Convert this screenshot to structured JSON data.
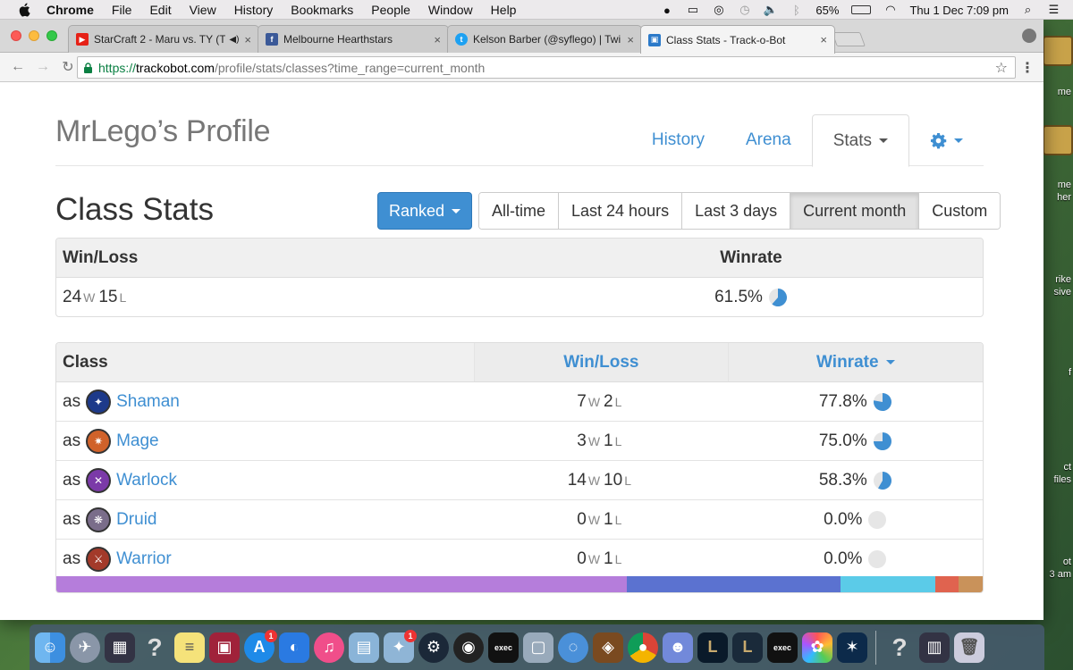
{
  "menubar": {
    "app_name": "Chrome",
    "menus": [
      "File",
      "Edit",
      "View",
      "History",
      "Bookmarks",
      "People",
      "Window",
      "Help"
    ],
    "battery": "65%",
    "clock": "Thu 1 Dec  7:09 pm"
  },
  "browser": {
    "tabs": [
      {
        "title": "StarCraft 2 - Maru vs. TY (T",
        "icon": "youtube-icon",
        "color": "#e62117"
      },
      {
        "title": "Melbourne Hearthstars",
        "icon": "facebook-icon",
        "color": "#3b5998"
      },
      {
        "title": "Kelson Barber (@syflego) | Twi",
        "icon": "twitter-icon",
        "color": "#1da1f2"
      },
      {
        "title": "Class Stats - Track-o-Bot",
        "icon": "trackobot-icon",
        "color": "#2c7ac9"
      }
    ],
    "url": {
      "scheme": "https://",
      "host": "trackobot.com",
      "path": "/profile/stats/classes?time_range=current_month"
    }
  },
  "page": {
    "profile_title": "MrLego’s Profile",
    "nav": {
      "history": "History",
      "arena": "Arena",
      "stats": "Stats"
    },
    "section_title": "Class Stats",
    "mode_button": "Ranked",
    "time_ranges": [
      "All-time",
      "Last 24 hours",
      "Last 3 days",
      "Current month",
      "Custom"
    ],
    "active_range": "Current month",
    "summary": {
      "col_winloss": "Win/Loss",
      "col_winrate": "Winrate",
      "wins": "24",
      "losses": "15",
      "win_suffix": "W",
      "loss_suffix": "L",
      "winrate": "61.5%",
      "winrate_fraction": 0.615
    },
    "classes_table": {
      "col_class": "Class",
      "col_winloss": "Win/Loss",
      "col_winrate": "Winrate",
      "as_label": "as",
      "rows": [
        {
          "name": "Shaman",
          "wins": "7",
          "losses": "2",
          "winrate": "77.8%",
          "fraction": 0.778,
          "icon_color": "#1d3a8a"
        },
        {
          "name": "Mage",
          "wins": "3",
          "losses": "1",
          "winrate": "75.0%",
          "fraction": 0.75,
          "icon_color": "#d0622a"
        },
        {
          "name": "Warlock",
          "wins": "14",
          "losses": "10",
          "winrate": "58.3%",
          "fraction": 0.583,
          "icon_color": "#7b3aa8"
        },
        {
          "name": "Druid",
          "wins": "0",
          "losses": "1",
          "winrate": "0.0%",
          "fraction": 0.0,
          "icon_color": "#7a6d8a"
        },
        {
          "name": "Warrior",
          "wins": "0",
          "losses": "1",
          "winrate": "0.0%",
          "fraction": 0.0,
          "icon_color": "#a33a2a"
        }
      ]
    },
    "distribution_bar": [
      {
        "class": "Warlock",
        "fraction": 0.6154,
        "color": "#b57ddb"
      },
      {
        "class": "Shaman",
        "fraction": 0.2308,
        "color": "#5b72d0"
      },
      {
        "class": "Mage",
        "fraction": 0.1026,
        "color": "#5bcbe8"
      },
      {
        "class": "Warrior",
        "fraction": 0.0256,
        "color": "#e0634f"
      },
      {
        "class": "Druid",
        "fraction": 0.0256,
        "color": "#c9925a"
      }
    ],
    "accent_color": "#3f8fd2"
  },
  "desktop": {
    "labels": [
      "me",
      "me",
      "her",
      "rike",
      "sive",
      "f",
      "ct",
      "files",
      "ot",
      "3 am"
    ]
  },
  "dock": {
    "badges": [
      "1",
      "1"
    ]
  }
}
